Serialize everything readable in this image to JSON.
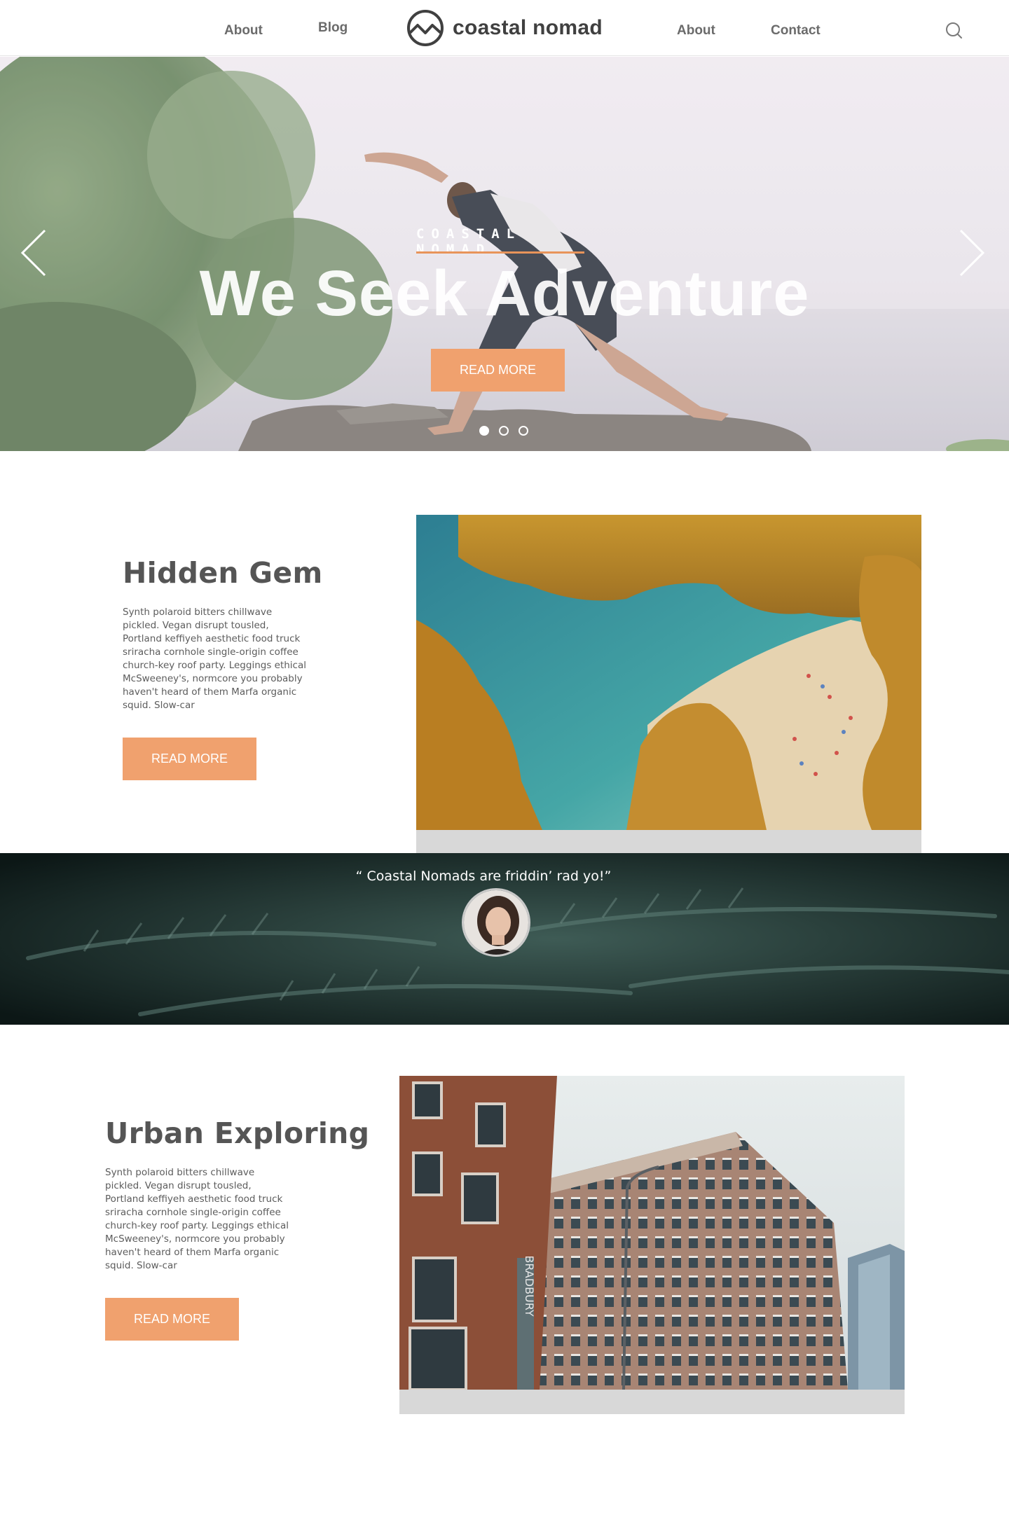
{
  "nav": {
    "links_left": [
      "About",
      "Blog"
    ],
    "links_right": [
      "About",
      "Contact"
    ],
    "brand": "coastal nomad",
    "search_icon": "search-icon"
  },
  "hero": {
    "eyebrow": "COASTAL NOMAD",
    "title": "We Seek Adventure",
    "cta": "READ MORE",
    "slides": 3,
    "active_slide": 1,
    "accent": "#f0a16e"
  },
  "features": [
    {
      "title": "Hidden Gem",
      "text": "Synth polaroid bitters chillwave pickled. Vegan disrupt tousled, Portland keffiyeh aesthetic food truck sriracha cornhole single-origin coffee church-key roof party. Leggings ethical McSweeney's, normcore you probably haven't heard of them Marfa organic squid. Slow-car",
      "cta": "READ MORE"
    },
    {
      "title": "Urban Exploring",
      "text": "Synth polaroid bitters chillwave pickled. Vegan disrupt tousled, Portland keffiyeh aesthetic food truck sriracha cornhole single-origin coffee church-key roof party. Leggings ethical McSweeney's, normcore you probably haven't heard of them Marfa organic squid. Slow-car",
      "cta": "READ MORE"
    }
  ],
  "testimonial": {
    "quote": "“ Coastal Nomads are friddin’ rad yo!”"
  },
  "colors": {
    "accent": "#f0a16e",
    "text": "#4a4a4a",
    "frame": "#d8d8d8"
  }
}
